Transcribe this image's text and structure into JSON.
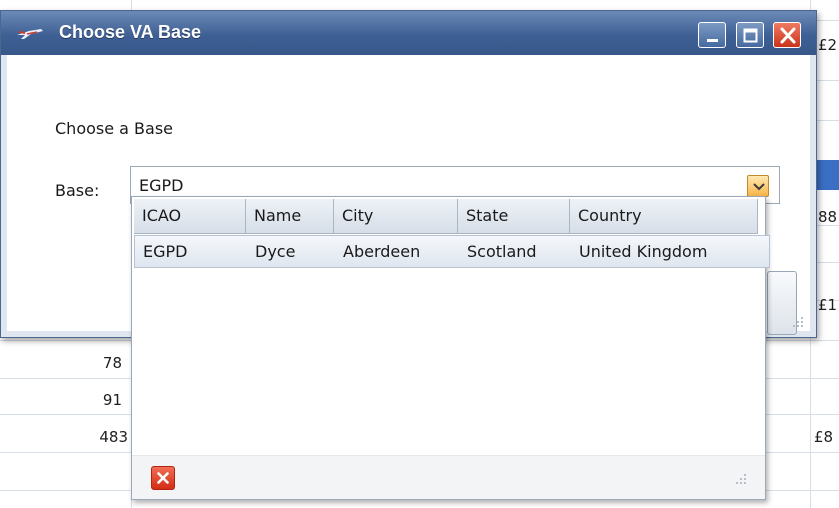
{
  "window": {
    "title": "Choose VA Base",
    "title_icon": "aircraft-icon",
    "controls": [
      "minimize-icon",
      "maximize-icon",
      "close-icon"
    ]
  },
  "form": {
    "heading": "Choose a Base",
    "base_label": "Base:",
    "base_value": "EGPD"
  },
  "dropdown": {
    "columns": [
      "ICAO",
      "Name",
      "City",
      "State",
      "Country"
    ],
    "rows": [
      [
        "EGPD",
        "Dyce",
        "Aberdeen",
        "Scotland",
        "United Kingdom"
      ]
    ],
    "clear_icon": "clear-selection-icon"
  },
  "background_sheet": {
    "left_values": [
      "78",
      "91",
      "483"
    ],
    "right_fragments": [
      "£2",
      "88",
      "£1",
      "£8"
    ]
  },
  "colors": {
    "titlebar": "#3f6094",
    "accent_dropdown_button": "#f8b44a",
    "close_button": "#c9341b",
    "row_highlight": "#dfe6ef"
  }
}
